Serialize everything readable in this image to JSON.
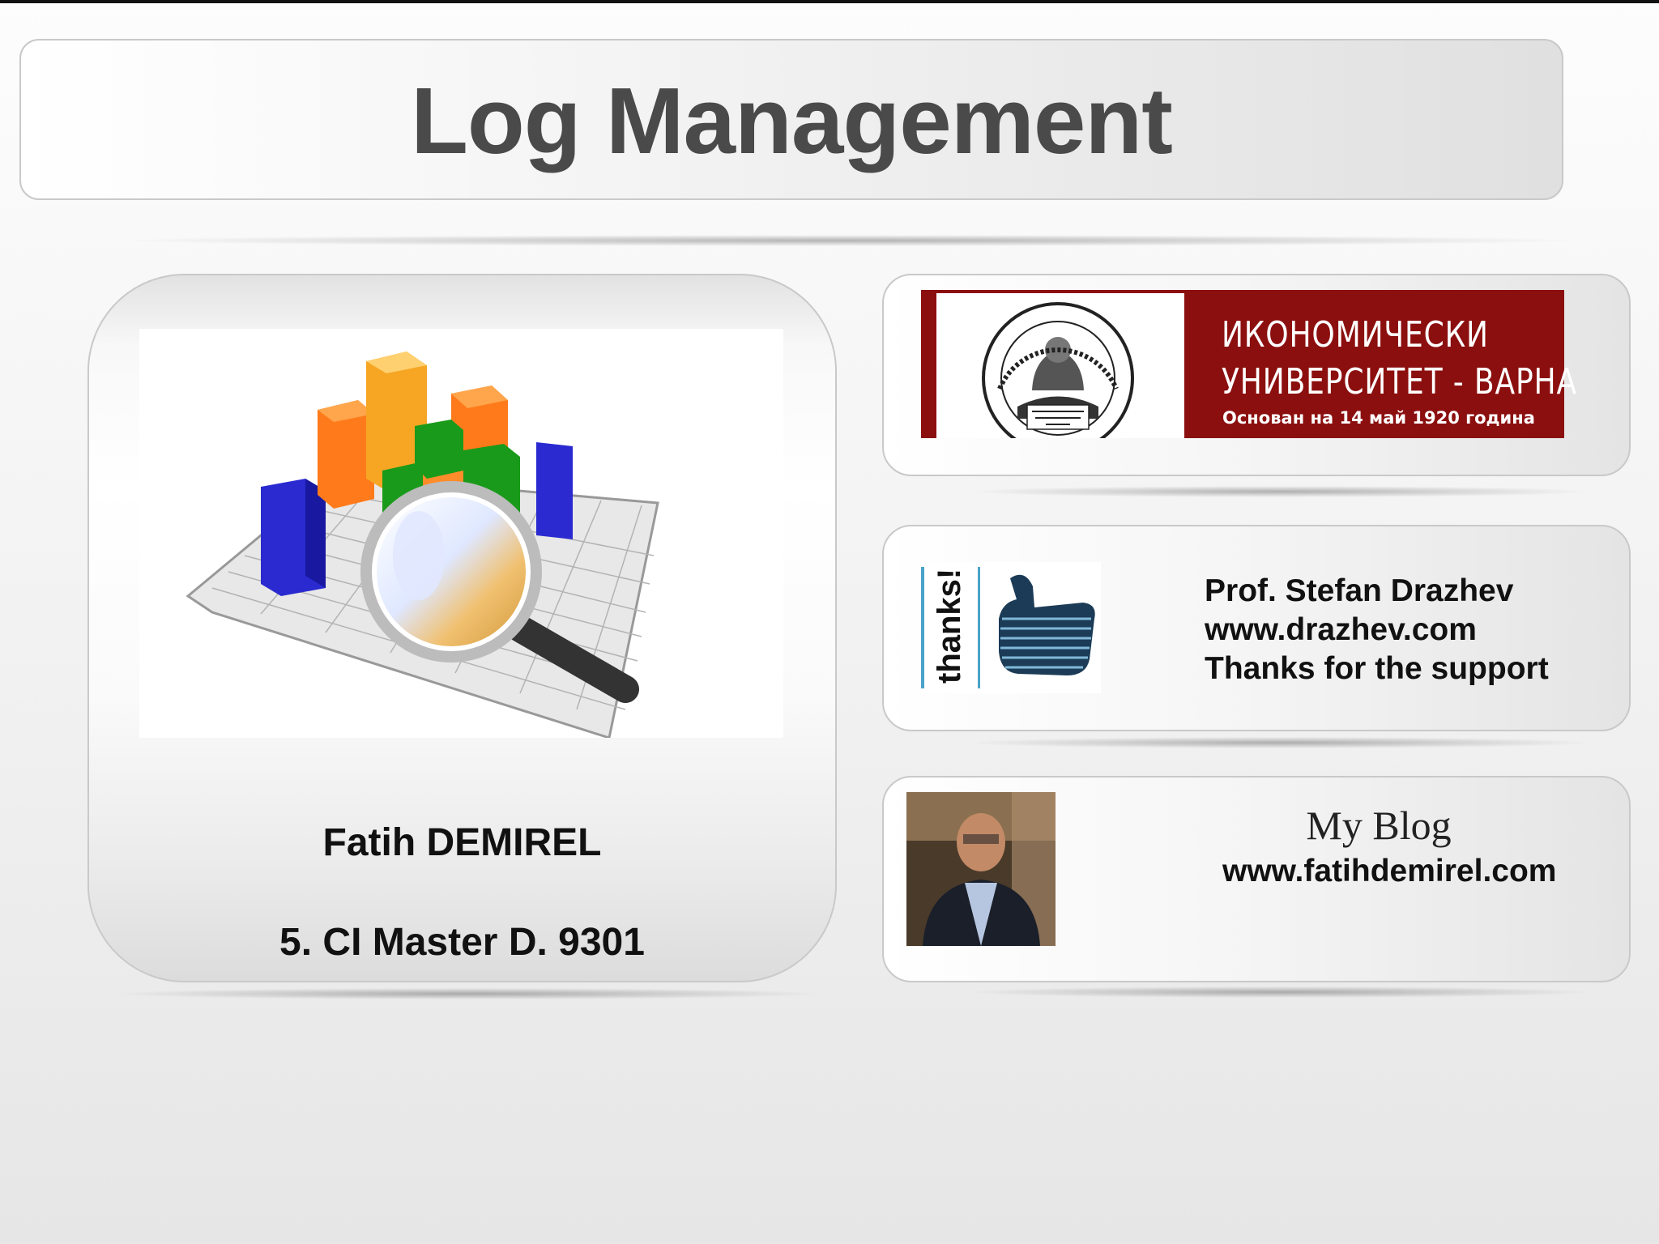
{
  "slide": {
    "title": "Log Management"
  },
  "author": {
    "name": "Fatih DEMIREL",
    "id": "5. CI Master D. 9301"
  },
  "university": {
    "name_line1": "ИКОНОМИЧЕСКИ",
    "name_line2": "УНИВЕРСИТЕТ  -  ВАРНА",
    "founded": "Основан на 14 май 1920 година",
    "brand_color": "#8c0f0f"
  },
  "professor": {
    "name": "Prof. Stefan Drazhev",
    "website": "www.drazhev.com",
    "thanks": "Thanks for the support"
  },
  "blog": {
    "title": "My Blog",
    "website": "www.fatihdemirel.com"
  },
  "icons": {
    "chart_image": "3d-bar-chart-magnifier-icon",
    "university_seal": "university-seal-icon",
    "thanks_image": "thumbs-up-thanks-icon",
    "author_photo": "author-photo"
  }
}
